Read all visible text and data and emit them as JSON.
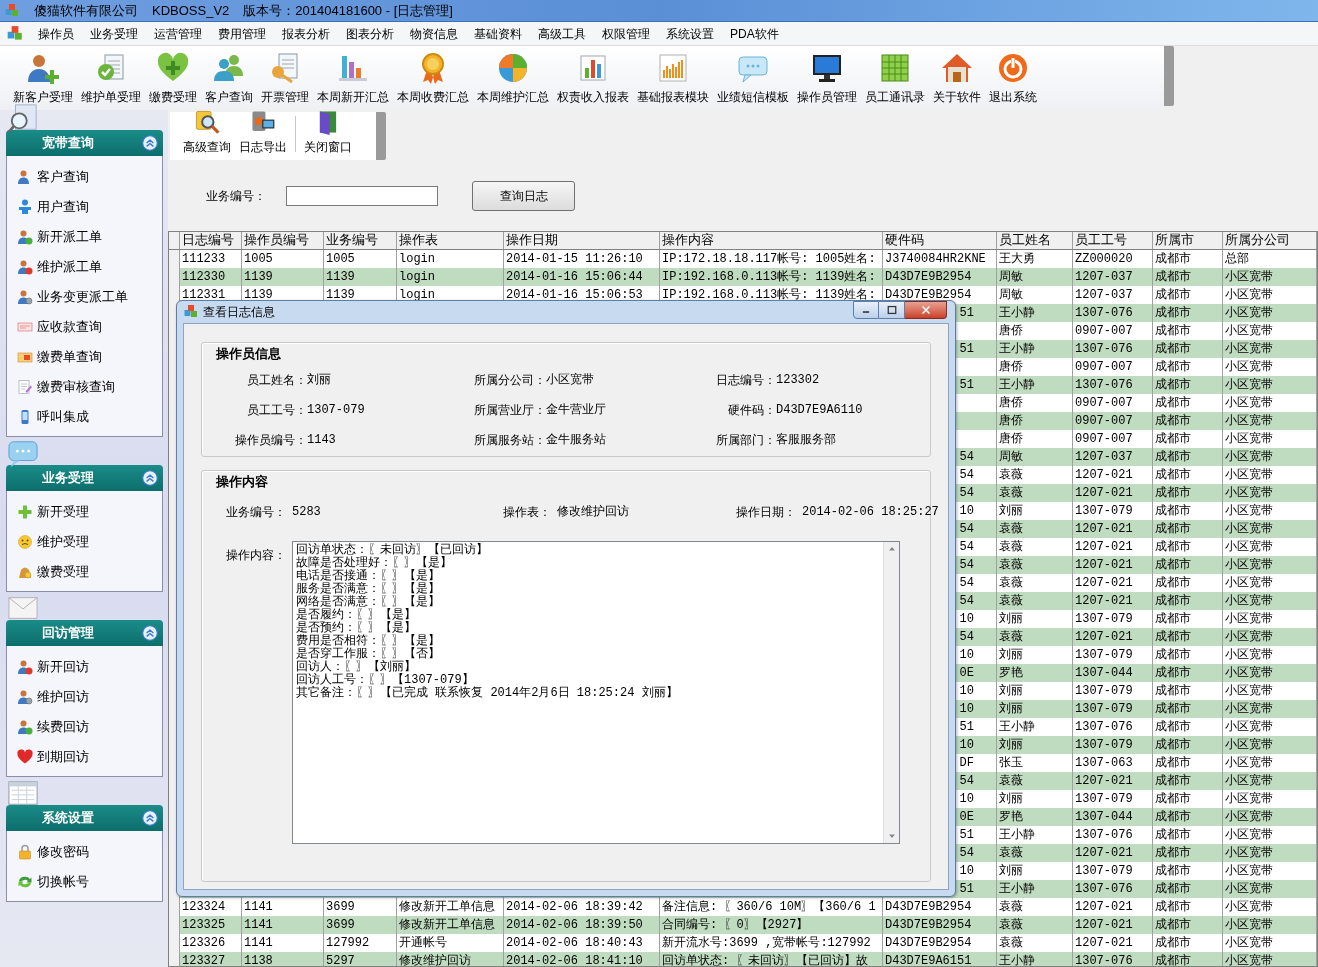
{
  "window": {
    "title": "傻猫软件有限公司",
    "app": "KDBOSS_V2",
    "version": "版本号：201404181600 - [日志管理]"
  },
  "menu": [
    "操作员",
    "业务受理",
    "运营管理",
    "费用管理",
    "报表分析",
    "图表分析",
    "物资信息",
    "基础资料",
    "高级工具",
    "权限管理",
    "系统设置",
    "PDA软件"
  ],
  "toolbar": [
    "新客户受理",
    "维护单受理",
    "缴费受理",
    "客户查询",
    "开票管理",
    "本周新开汇总",
    "本周收费汇总",
    "本周维护汇总",
    "权责收入报表",
    "基础报表模块",
    "业绩短信模板",
    "操作员管理",
    "员工通讯录",
    "关于软件",
    "退出系统"
  ],
  "sidebar": [
    {
      "title": "宽带查询",
      "expanded": true,
      "items": [
        "客户查询",
        "用户查询",
        "新开派工单",
        "维护派工单",
        "业务变更派工单",
        "应收款查询",
        "缴费单查询",
        "缴费审核查询",
        "呼叫集成"
      ]
    },
    {
      "title": "业务受理",
      "expanded": true,
      "items": [
        "新开受理",
        "维护受理",
        "缴费受理"
      ]
    },
    {
      "title": "回访管理",
      "expanded": true,
      "items": [
        "新开回访",
        "维护回访",
        "续费回访",
        "到期回访"
      ]
    },
    {
      "title": "系统设置",
      "expanded": true,
      "items": [
        "修改密码",
        "切换帐号"
      ]
    }
  ],
  "subtoolbar": [
    "高级查询",
    "日志导出",
    "关闭窗口"
  ],
  "search": {
    "label": "业务编号：",
    "button": "查询日志"
  },
  "table": {
    "columns": [
      "日志编号",
      "操作员编号",
      "业务编号",
      "操作表",
      "操作日期",
      "操作内容",
      "硬件码",
      "员工姓名",
      "员工工号",
      "所属市",
      "所属分公司"
    ],
    "rows": [
      {
        "kind": "full",
        "cells": [
          "111233",
          "1005",
          "1005",
          "login",
          "2014-01-15 11:26:10",
          "IP:172.18.18.117帐号: 1005姓名:",
          "J3740084HR2KNE",
          "王大勇",
          "ZZ000020",
          "成都市",
          "总部"
        ]
      },
      {
        "kind": "full",
        "cells": [
          "112330",
          "1139",
          "1139",
          "login",
          "2014-01-16 15:06:44",
          "IP:192.168.0.113帐号: 1139姓名:",
          "D43D7E9B2954",
          "周敏",
          "1207-037",
          "成都市",
          "小区宽带"
        ]
      },
      {
        "kind": "full",
        "cells": [
          "112331",
          "1139",
          "1139",
          "login",
          "2014-01-16 15:06:53",
          "IP:192.168.0.113帐号: 1139姓名:",
          "D43D7E9B2954",
          "周敏",
          "1207-037",
          "成都市",
          "小区宽带"
        ]
      },
      {
        "kind": "covered",
        "hardware_code_tail": "51",
        "cells": [
          "王小静",
          "1307-076",
          "成都市",
          "小区宽带"
        ]
      },
      {
        "kind": "covered",
        "cells": [
          "唐侨",
          "0907-007",
          "成都市",
          "小区宽带"
        ]
      },
      {
        "kind": "covered",
        "hardware_code_tail": "51",
        "cells": [
          "王小静",
          "1307-076",
          "成都市",
          "小区宽带"
        ]
      },
      {
        "kind": "covered",
        "cells": [
          "唐侨",
          "0907-007",
          "成都市",
          "小区宽带"
        ]
      },
      {
        "kind": "covered",
        "hardware_code_tail": "51",
        "cells": [
          "王小静",
          "1307-076",
          "成都市",
          "小区宽带"
        ]
      },
      {
        "kind": "covered",
        "cells": [
          "唐侨",
          "0907-007",
          "成都市",
          "小区宽带"
        ]
      },
      {
        "kind": "covered",
        "cells": [
          "唐侨",
          "0907-007",
          "成都市",
          "小区宽带"
        ]
      },
      {
        "kind": "covered",
        "cells": [
          "唐侨",
          "0907-007",
          "成都市",
          "小区宽带"
        ]
      },
      {
        "kind": "covered",
        "hardware_code_tail": "54",
        "cells": [
          "周敏",
          "1207-037",
          "成都市",
          "小区宽带"
        ]
      },
      {
        "kind": "covered",
        "hardware_code_tail": "54",
        "cells": [
          "袁薇",
          "1207-021",
          "成都市",
          "小区宽带"
        ]
      },
      {
        "kind": "covered",
        "hardware_code_tail": "54",
        "cells": [
          "袁薇",
          "1207-021",
          "成都市",
          "小区宽带"
        ]
      },
      {
        "kind": "covered",
        "hardware_code_tail": "10",
        "cells": [
          "刘丽",
          "1307-079",
          "成都市",
          "小区宽带"
        ]
      },
      {
        "kind": "covered",
        "hardware_code_tail": "54",
        "cells": [
          "袁薇",
          "1207-021",
          "成都市",
          "小区宽带"
        ]
      },
      {
        "kind": "covered",
        "hardware_code_tail": "54",
        "cells": [
          "袁薇",
          "1207-021",
          "成都市",
          "小区宽带"
        ]
      },
      {
        "kind": "covered",
        "hardware_code_tail": "54",
        "cells": [
          "袁薇",
          "1207-021",
          "成都市",
          "小区宽带"
        ]
      },
      {
        "kind": "covered",
        "hardware_code_tail": "54",
        "cells": [
          "袁薇",
          "1207-021",
          "成都市",
          "小区宽带"
        ]
      },
      {
        "kind": "covered",
        "hardware_code_tail": "54",
        "cells": [
          "袁薇",
          "1207-021",
          "成都市",
          "小区宽带"
        ]
      },
      {
        "kind": "covered",
        "hardware_code_tail": "10",
        "cells": [
          "刘丽",
          "1307-079",
          "成都市",
          "小区宽带"
        ]
      },
      {
        "kind": "covered",
        "hardware_code_tail": "54",
        "cells": [
          "袁薇",
          "1207-021",
          "成都市",
          "小区宽带"
        ]
      },
      {
        "kind": "covered",
        "hardware_code_tail": "10",
        "cells": [
          "刘丽",
          "1307-079",
          "成都市",
          "小区宽带"
        ]
      },
      {
        "kind": "covered",
        "hardware_code_tail": "0E",
        "cells": [
          "罗艳",
          "1307-044",
          "成都市",
          "小区宽带"
        ]
      },
      {
        "kind": "covered",
        "hardware_code_tail": "10",
        "cells": [
          "刘丽",
          "1307-079",
          "成都市",
          "小区宽带"
        ]
      },
      {
        "kind": "covered",
        "hardware_code_tail": "10",
        "cells": [
          "刘丽",
          "1307-079",
          "成都市",
          "小区宽带"
        ]
      },
      {
        "kind": "covered",
        "hardware_code_tail": "51",
        "cells": [
          "王小静",
          "1307-076",
          "成都市",
          "小区宽带"
        ]
      },
      {
        "kind": "covered",
        "hardware_code_tail": "10",
        "cells": [
          "刘丽",
          "1307-079",
          "成都市",
          "小区宽带"
        ]
      },
      {
        "kind": "covered",
        "hardware_code_tail": "DF",
        "cells": [
          "张玉",
          "1307-063",
          "成都市",
          "小区宽带"
        ]
      },
      {
        "kind": "covered",
        "hardware_code_tail": "54",
        "cells": [
          "袁薇",
          "1207-021",
          "成都市",
          "小区宽带"
        ]
      },
      {
        "kind": "covered",
        "hardware_code_tail": "10",
        "cells": [
          "刘丽",
          "1307-079",
          "成都市",
          "小区宽带"
        ]
      },
      {
        "kind": "covered",
        "hardware_code_tail": "0E",
        "cells": [
          "罗艳",
          "1307-044",
          "成都市",
          "小区宽带"
        ]
      },
      {
        "kind": "covered",
        "hardware_code_tail": "51",
        "cells": [
          "王小静",
          "1307-076",
          "成都市",
          "小区宽带"
        ]
      },
      {
        "kind": "covered",
        "hardware_code_tail": "54",
        "cells": [
          "袁薇",
          "1207-021",
          "成都市",
          "小区宽带"
        ]
      },
      {
        "kind": "covered",
        "hardware_code_tail": "10",
        "cells": [
          "刘丽",
          "1307-079",
          "成都市",
          "小区宽带"
        ]
      },
      {
        "kind": "covered",
        "hardware_code_tail": "51",
        "cells": [
          "王小静",
          "1307-076",
          "成都市",
          "小区宽带"
        ]
      },
      {
        "kind": "full",
        "cells": [
          "123324",
          "1141",
          "3699",
          "修改新开工单信息",
          "2014-02-06 18:39:42",
          "备注信息: 〖360/6 10M〗【360/6 1",
          "D43D7E9B2954",
          "袁薇",
          "1207-021",
          "成都市",
          "小区宽带"
        ]
      },
      {
        "kind": "full",
        "cells": [
          "123325",
          "1141",
          "3699",
          "修改新开工单信息",
          "2014-02-06 18:39:50",
          "合同编号: 〖0〗【2927】",
          "D43D7E9B2954",
          "袁薇",
          "1207-021",
          "成都市",
          "小区宽带"
        ]
      },
      {
        "kind": "full",
        "cells": [
          "123326",
          "1141",
          "127992",
          "开通帐号",
          "2014-02-06 18:40:43",
          "新开流水号:3699 ,宽带帐号:127992",
          "D43D7E9B2954",
          "袁薇",
          "1207-021",
          "成都市",
          "小区宽带"
        ]
      },
      {
        "kind": "full",
        "cells": [
          "123327",
          "1138",
          "5297",
          "修改维护回访",
          "2014-02-06 18:41:10",
          "回访单状态: 〖未回访〗【已回访】故",
          "D43D7E9A6151",
          "王小静",
          "1307-076",
          "成都市",
          "小区宽带"
        ]
      }
    ]
  },
  "dialog": {
    "title": "查看日志信息",
    "operator_section": {
      "title": "操作员信息",
      "fields": [
        {
          "label": "员工姓名：",
          "value": "刘丽"
        },
        {
          "label": "所属分公司：",
          "value": "小区宽带"
        },
        {
          "label": "日志编号：",
          "value": "123302"
        },
        {
          "label": "员工工号：",
          "value": "1307-079"
        },
        {
          "label": "所属营业厅：",
          "value": "金牛营业厅"
        },
        {
          "label": "硬件码：",
          "value": "D43D7E9A6110"
        },
        {
          "label": "操作员编号：",
          "value": "1143"
        },
        {
          "label": "所属服务站：",
          "value": "金牛服务站"
        },
        {
          "label": "所属部门：",
          "value": "客服服务部"
        }
      ]
    },
    "content_section": {
      "title": "操作内容",
      "fields": [
        {
          "label": "业务编号：",
          "value": "5283"
        },
        {
          "label": "操作表：",
          "value": "修改维护回访"
        },
        {
          "label": "操作日期：",
          "value": "2014-02-06 18:25:27"
        }
      ],
      "content_label": "操作内容：",
      "content_lines": [
        "回访单状态：〖未回访〗【已回访】",
        "故障是否处理好：〖〗【是】",
        "电话是否接通：〖〗【是】",
        "服务是否满意：〖〗【是】",
        "网络是否满意：〖〗【是】",
        "是否履约：〖〗【是】",
        "是否预约：〖〗【是】",
        "费用是否相符：〖〗【是】",
        "是否穿工作服：〖〗【否】",
        "回访人：〖〗【刘丽】",
        "回访人工号：〖〗【1307-079】",
        "其它备注：〖〗【已完成 联系恢复 2014年2月6日 18:25:24 刘丽】"
      ]
    }
  }
}
